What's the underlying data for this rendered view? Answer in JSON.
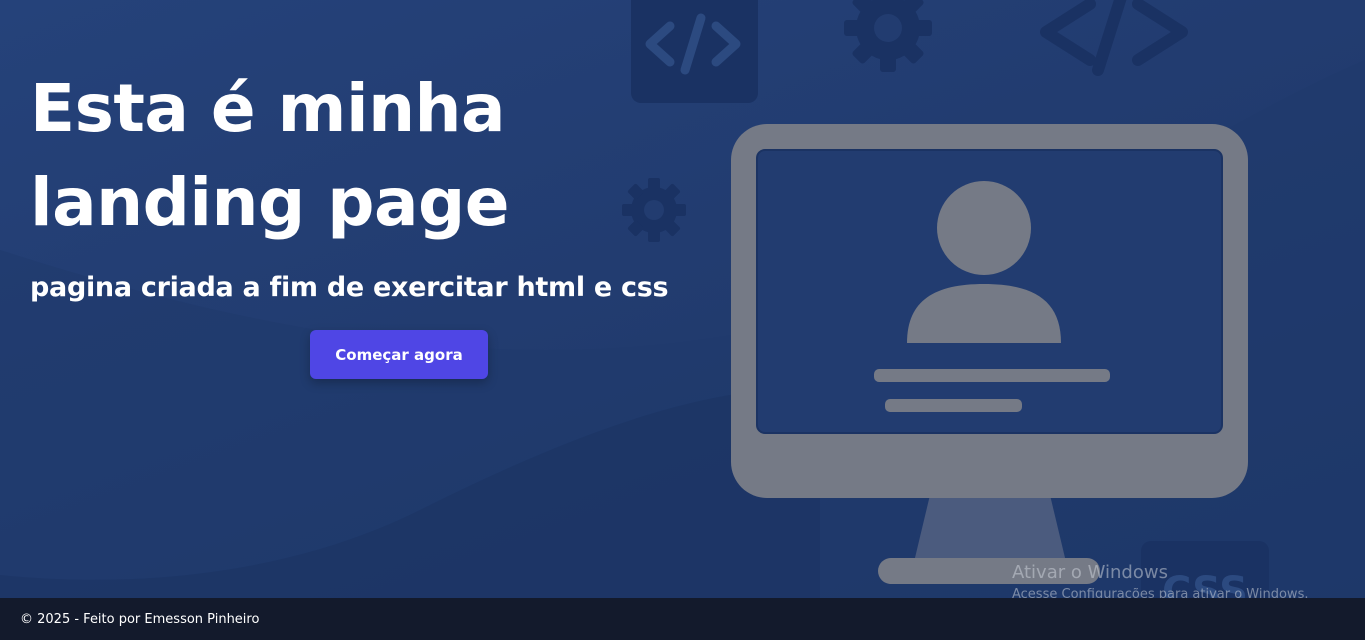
{
  "hero": {
    "title": "Esta é minha landing page",
    "subtitle": "pagina criada a fim de exercitar html e css",
    "cta_label": "Começar agora"
  },
  "illustration": {
    "icons": [
      "code-icon",
      "gear-icon",
      "code-icon",
      "gear-icon",
      "monitor-user-icon",
      "css-badge-icon"
    ],
    "badge_text": "CSS"
  },
  "watermark": {
    "title": "Ativar o Windows",
    "subtitle": "Acesse Configurações para ativar o Windows."
  },
  "footer": {
    "text": "© 2025 - Feito por Emesson Pinheiro"
  },
  "colors": {
    "background": "#223c70",
    "button": "#4f46e5",
    "footer": "#131a2c",
    "illustration": "#757a86"
  }
}
